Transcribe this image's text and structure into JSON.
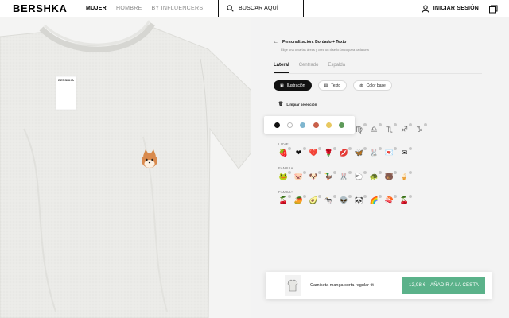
{
  "brand": {
    "logo": "BERSHKA"
  },
  "nav": {
    "items": [
      {
        "label": "MUJER",
        "active": true
      },
      {
        "label": "HOMBRE",
        "active": false
      },
      {
        "label": "BY INFLUENCERS",
        "active": false
      }
    ]
  },
  "search": {
    "label": "BUSCAR AQUÍ",
    "icon": "search-icon"
  },
  "login": {
    "label": "INICIAR SESIÓN",
    "icon": "user-icon"
  },
  "cart": {
    "icon": "shopping-bag-icon"
  },
  "product_image": {
    "shirt_color": "#ececea",
    "tag_text": "BERSHKA",
    "patch": "shiba-dog-embroidery"
  },
  "customizer": {
    "title": "Personalización: Bordado + Texto",
    "subtitle": "Elige una o varias áreas y crea un diseño único para cada una",
    "tabs": [
      {
        "label": "Lateral",
        "active": true
      },
      {
        "label": "Centrado",
        "active": false
      },
      {
        "label": "Espalda",
        "active": false
      }
    ],
    "chips": [
      {
        "label": "Ilustración",
        "active": true,
        "icon": "illustration-icon"
      },
      {
        "label": "Texto",
        "active": false,
        "icon": "text-icon"
      },
      {
        "label": "Color base",
        "active": false,
        "icon": "palette-icon"
      }
    ],
    "clear_label": "Limpiar selección",
    "color_swatches": [
      "#111111",
      "#ffffff",
      "#7fb6cf",
      "#c9604a",
      "#e8c860",
      "#5e9a5a"
    ],
    "sections": [
      {
        "label": "ZOD",
        "icons": [
          "♈",
          "♉",
          "♊",
          "♋",
          "♌",
          "♍",
          "♎",
          "♏",
          "♐",
          "♑"
        ]
      },
      {
        "label": "LOVE",
        "icons": [
          "🍓",
          "❤",
          "💔",
          "🌹",
          "💋",
          "🦋",
          "🐰",
          "💌",
          "✉"
        ]
      },
      {
        "label": "FAMILIA",
        "icons": [
          "🐸",
          "🐷",
          "🐶",
          "🦆",
          "🐰",
          "🐑",
          "🐢",
          "🐻",
          "🍦"
        ]
      },
      {
        "label": "FAMILIA",
        "icons": [
          "🍒",
          "🥭",
          "🥑",
          "🐄",
          "👽",
          "🐼",
          "🌈",
          "🍣",
          "🍒"
        ]
      }
    ]
  },
  "bottom_bar": {
    "product_name": "Camiseta manga corta regular fit",
    "button_label": "12,98 € · AÑADIR A LA CESTA",
    "button_color": "#5bb28a"
  }
}
